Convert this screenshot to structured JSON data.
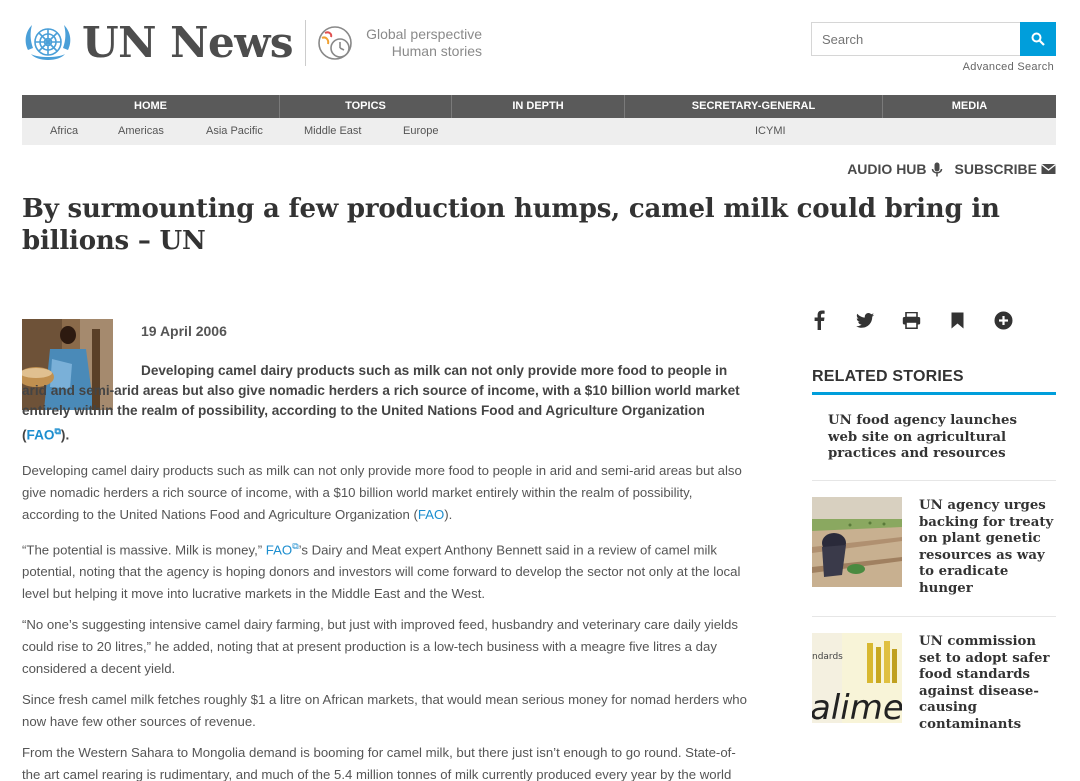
{
  "header": {
    "logo": "UN News",
    "tagline_line1": "Global perspective",
    "tagline_line2": "Human stories",
    "search_placeholder": "Search",
    "advanced_search": "Advanced Search"
  },
  "nav": {
    "main": [
      "HOME",
      "TOPICS",
      "IN DEPTH",
      "SECRETARY-GENERAL",
      "MEDIA"
    ],
    "sub": [
      "Africa",
      "Americas",
      "Asia Pacific",
      "Middle East",
      "Europe",
      "ICYMI"
    ]
  },
  "utility": {
    "audio_hub": "AUDIO HUB",
    "subscribe": "SUBSCRIBE"
  },
  "article": {
    "headline": "By surmounting a few production humps, camel milk could bring in billions – UN",
    "date": "19 April 2006",
    "lead_text": "Developing camel dairy products such as milk can not only provide more food to people in arid and semi-arid areas but also give nomadic herders a rich source of income, with a $10 billion world market entirely within the realm of possibility, according to the United Nations Food and Agriculture Organization (",
    "lead_link": "FAO",
    "lead_end": ").",
    "p1_text": "Developing camel dairy products such as milk can not only provide more food to people in arid and semi-arid areas but also give nomadic herders a rich source of income, with a $10 billion world market entirely within the realm of possibility, according to the United Nations Food and Agriculture Organization (",
    "p1_link": "FAO",
    "p1_end": ").",
    "p2_start": "“The potential is massive. Milk is money,” ",
    "p2_link": "FAO",
    "p2_rest": "’s Dairy and Meat expert Anthony Bennett said in a review of camel milk potential, noting that the agency is hoping donors and investors will come forward to develop the sector not only at the local level but helping it move into lucrative markets in the Middle East and the West.",
    "p3": "“No one’s suggesting intensive camel dairy farming, but just with improved feed, husbandry and veterinary care daily yields could rise to 20 litres,” he added, noting that at present production is a low-tech business with a meagre five litres a day considered a decent yield.",
    "p4": "Since fresh camel milk fetches roughly $1 a litre on African markets, that would mean serious money for nomad herders who now have few other sources of revenue.",
    "p5": "From the Western Sahara to Mongolia demand is booming for camel milk, but there just isn’t enough to go round. State-of-the art camel rearing is rudimentary, and much of the 5.4 million tonnes of milk currently produced every year by the world"
  },
  "sidebar": {
    "related_title": "RELATED STORIES",
    "stories": [
      "UN food agency launches web site on agricultural practices and resources",
      "UN agency urges backing for treaty on plant genetic resources as way to eradicate hunger",
      "UN commission set to adopt safer food standards against disease-causing contaminants"
    ]
  },
  "colors": {
    "accent": "#009edb",
    "nav_bg": "#5a5a5a",
    "subnav_bg": "#eeeeee",
    "link": "#1d8ecf"
  }
}
